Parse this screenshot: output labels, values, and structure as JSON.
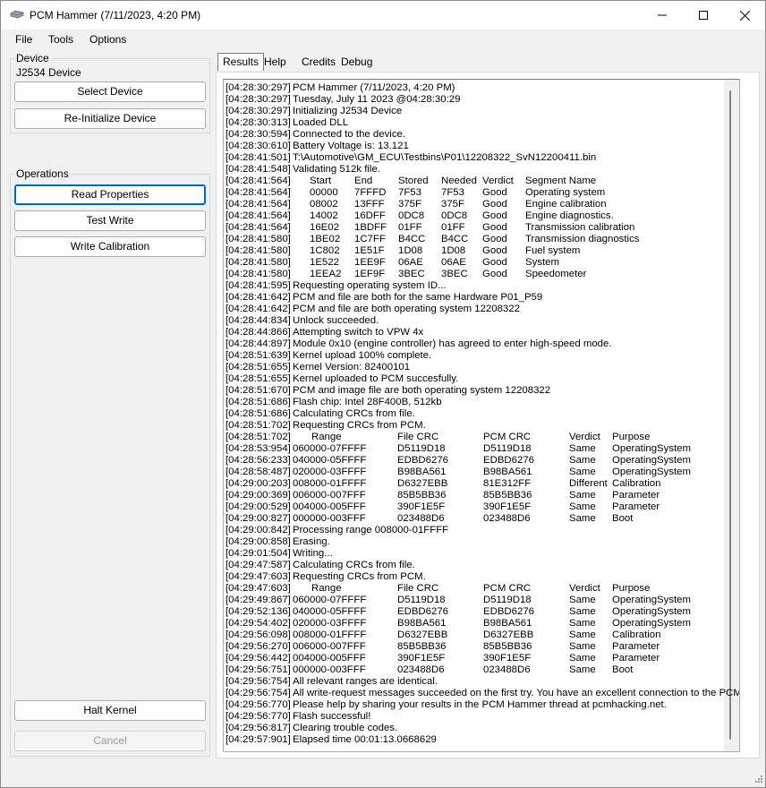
{
  "window": {
    "title": "PCM Hammer (7/11/2023, 4:20 PM)",
    "controls": {
      "minimize": "—",
      "maximize": "☐",
      "close": "✕"
    }
  },
  "menu": [
    {
      "label": "File"
    },
    {
      "label": "Tools"
    },
    {
      "label": "Options"
    }
  ],
  "device_group": {
    "label": "Device",
    "device_name": "J2534 Device",
    "select_device": "Select Device",
    "reinitialize_device": "Re-Initialize Device"
  },
  "operations_group": {
    "label": "Operations",
    "read_properties": "Read Properties",
    "test_write": "Test Write",
    "write_calibration": "Write Calibration",
    "halt_kernel": "Halt Kernel",
    "cancel": "Cancel"
  },
  "tabs": [
    {
      "label": "Results",
      "active": true
    },
    {
      "label": "Help",
      "active": false
    },
    {
      "label": "Credits",
      "active": false
    },
    {
      "label": "Debug Log",
      "active": false
    }
  ],
  "log": {
    "lines": [
      {
        "t": "[04:28:30:297]",
        "text": "PCM Hammer (7/11/2023, 4:20 PM)"
      },
      {
        "t": "[04:28:30:297]",
        "text": "Tuesday, July 11 2023 @04:28:30:29"
      },
      {
        "t": "[04:28:30:297]",
        "text": "Initializing J2534 Device"
      },
      {
        "t": "[04:28:30:313]",
        "text": "Loaded DLL"
      },
      {
        "t": "[04:28:30:594]",
        "text": "Connected to the device."
      },
      {
        "t": "[04:28:30:610]",
        "text": "Battery Voltage is: 13.121"
      },
      {
        "t": "[04:28:41:501]",
        "text": "T:\\Automotive\\GM_ECU\\Testbins\\P01\\12208322_SvN12200411.bin"
      },
      {
        "t": "[04:28:41:548]",
        "text": "Validating 512k file."
      },
      {
        "t": "[04:28:41:564]",
        "cols": [
          "Start",
          "End",
          "Stored",
          "Needed",
          "Verdict",
          "Segment Name"
        ]
      },
      {
        "t": "[04:28:41:564]",
        "cols": [
          "00000",
          "7FFFD",
          "7F53",
          "7F53",
          "Good",
          "Operating system"
        ]
      },
      {
        "t": "[04:28:41:564]",
        "cols": [
          "08002",
          "13FFF",
          "375F",
          "375F",
          "Good",
          "Engine calibration"
        ]
      },
      {
        "t": "[04:28:41:564]",
        "cols": [
          "14002",
          "16DFF",
          "0DC8",
          "0DC8",
          "Good",
          "Engine diagnostics."
        ]
      },
      {
        "t": "[04:28:41:564]",
        "cols": [
          "16E02",
          "1BDFF",
          "01FF",
          "01FF",
          "Good",
          "Transmission calibration"
        ]
      },
      {
        "t": "[04:28:41:580]",
        "cols": [
          "1BE02",
          "1C7FF",
          "B4CC",
          "B4CC",
          "Good",
          "Transmission diagnostics"
        ]
      },
      {
        "t": "[04:28:41:580]",
        "cols": [
          "1C802",
          "1E51F",
          "1D08",
          "1D08",
          "Good",
          "Fuel system"
        ]
      },
      {
        "t": "[04:28:41:580]",
        "cols": [
          "1E522",
          "1EE9F",
          "06AE",
          "06AE",
          "Good",
          "System"
        ]
      },
      {
        "t": "[04:28:41:580]",
        "cols": [
          "1EEA2",
          "1EF9F",
          "3BEC",
          "3BEC",
          "Good",
          "Speedometer"
        ]
      },
      {
        "t": "[04:28:41:595]",
        "text": "Requesting operating system ID..."
      },
      {
        "t": "[04:28:41:642]",
        "text": "PCM and file are both for the same Hardware P01_P59"
      },
      {
        "t": "[04:28:41:642]",
        "text": "PCM and file are both operating system 12208322"
      },
      {
        "t": "[04:28:44:834]",
        "text": "Unlock succeeded."
      },
      {
        "t": "[04:28:44:866]",
        "text": "Attempting switch to VPW 4x"
      },
      {
        "t": "[04:28:44:897]",
        "text": "Module 0x10 (engine controller) has agreed to enter high-speed mode."
      },
      {
        "t": "[04:28:51:639]",
        "text": "Kernel upload 100% complete."
      },
      {
        "t": "[04:28:51:655]",
        "text": "Kernel Version: 82400101"
      },
      {
        "t": "[04:28:51:655]",
        "text": "Kernel uploaded to PCM succesfully."
      },
      {
        "t": "[04:28:51:670]",
        "text": "PCM and image file are both operating system 12208322"
      },
      {
        "t": "[04:28:51:686]",
        "text": "Flash chip: Intel 28F400B, 512kb"
      },
      {
        "t": "[04:28:51:686]",
        "text": "Calculating CRCs from file."
      },
      {
        "t": "[04:28:51:702]",
        "text": "Requesting CRCs from PCM."
      },
      {
        "t": "[04:28:51:702]",
        "crc": [
          "Range",
          "File CRC",
          "PCM CRC",
          "Verdict",
          "Purpose"
        ]
      },
      {
        "t": "[04:28:53:954]",
        "crc": [
          "060000-07FFFF",
          "D5119D18",
          "D5119D18",
          "Same",
          "OperatingSystem"
        ]
      },
      {
        "t": "[04:28:56:233]",
        "crc": [
          "040000-05FFFF",
          "EDBD6276",
          "EDBD6276",
          "Same",
          "OperatingSystem"
        ]
      },
      {
        "t": "[04:28:58:487]",
        "crc": [
          "020000-03FFFF",
          "B98BA561",
          "B98BA561",
          "Same",
          "OperatingSystem"
        ]
      },
      {
        "t": "[04:29:00:203]",
        "crc": [
          "008000-01FFFF",
          "D6327EBB",
          "81E312FF",
          "Different",
          "Calibration"
        ]
      },
      {
        "t": "[04:29:00:369]",
        "crc": [
          "006000-007FFF",
          "85B5BB36",
          "85B5BB36",
          "Same",
          "Parameter"
        ]
      },
      {
        "t": "[04:29:00:529]",
        "crc": [
          "004000-005FFF",
          "390F1E5F",
          "390F1E5F",
          "Same",
          "Parameter"
        ]
      },
      {
        "t": "[04:29:00:827]",
        "crc": [
          "000000-003FFF",
          "023488D6",
          "023488D6",
          "Same",
          "Boot"
        ]
      },
      {
        "t": "[04:29:00:842]",
        "text": "Processing range 008000-01FFFF"
      },
      {
        "t": "[04:29:00:858]",
        "text": "Erasing."
      },
      {
        "t": "[04:29:01:504]",
        "text": "Writing..."
      },
      {
        "t": "[04:29:47:587]",
        "text": "Calculating CRCs from file."
      },
      {
        "t": "[04:29:47:603]",
        "text": "Requesting CRCs from PCM."
      },
      {
        "t": "[04:29:47:603]",
        "crc": [
          "Range",
          "File CRC",
          "PCM CRC",
          "Verdict",
          "Purpose"
        ]
      },
      {
        "t": "[04:29:49:867]",
        "crc": [
          "060000-07FFFF",
          "D5119D18",
          "D5119D18",
          "Same",
          "OperatingSystem"
        ]
      },
      {
        "t": "[04:29:52:136]",
        "crc": [
          "040000-05FFFF",
          "EDBD6276",
          "EDBD6276",
          "Same",
          "OperatingSystem"
        ]
      },
      {
        "t": "[04:29:54:402]",
        "crc": [
          "020000-03FFFF",
          "B98BA561",
          "B98BA561",
          "Same",
          "OperatingSystem"
        ]
      },
      {
        "t": "[04:29:56:098]",
        "crc": [
          "008000-01FFFF",
          "D6327EBB",
          "D6327EBB",
          "Same",
          "Calibration"
        ]
      },
      {
        "t": "[04:29:56:270]",
        "crc": [
          "006000-007FFF",
          "85B5BB36",
          "85B5BB36",
          "Same",
          "Parameter"
        ]
      },
      {
        "t": "[04:29:56:442]",
        "crc": [
          "004000-005FFF",
          "390F1E5F",
          "390F1E5F",
          "Same",
          "Parameter"
        ]
      },
      {
        "t": "[04:29:56:751]",
        "crc": [
          "000000-003FFF",
          "023488D6",
          "023488D6",
          "Same",
          "Boot"
        ]
      },
      {
        "t": "[04:29:56:754]",
        "text": "All relevant ranges are identical."
      },
      {
        "t": "[04:29:56:754]",
        "text": "All write-request messages succeeded on the first try. You have an excellent connection to the PCM."
      },
      {
        "t": "[04:29:56:770]",
        "text": "Please help by sharing your results in the PCM Hammer thread at pcmhacking.net."
      },
      {
        "t": "[04:29:56:770]",
        "text": "Flash successful!"
      },
      {
        "t": "[04:29:56:817]",
        "text": "Clearing trouble codes."
      },
      {
        "t": "[04:29:57:901]",
        "text": "Elapsed time 00:01:13.0668629"
      }
    ]
  }
}
